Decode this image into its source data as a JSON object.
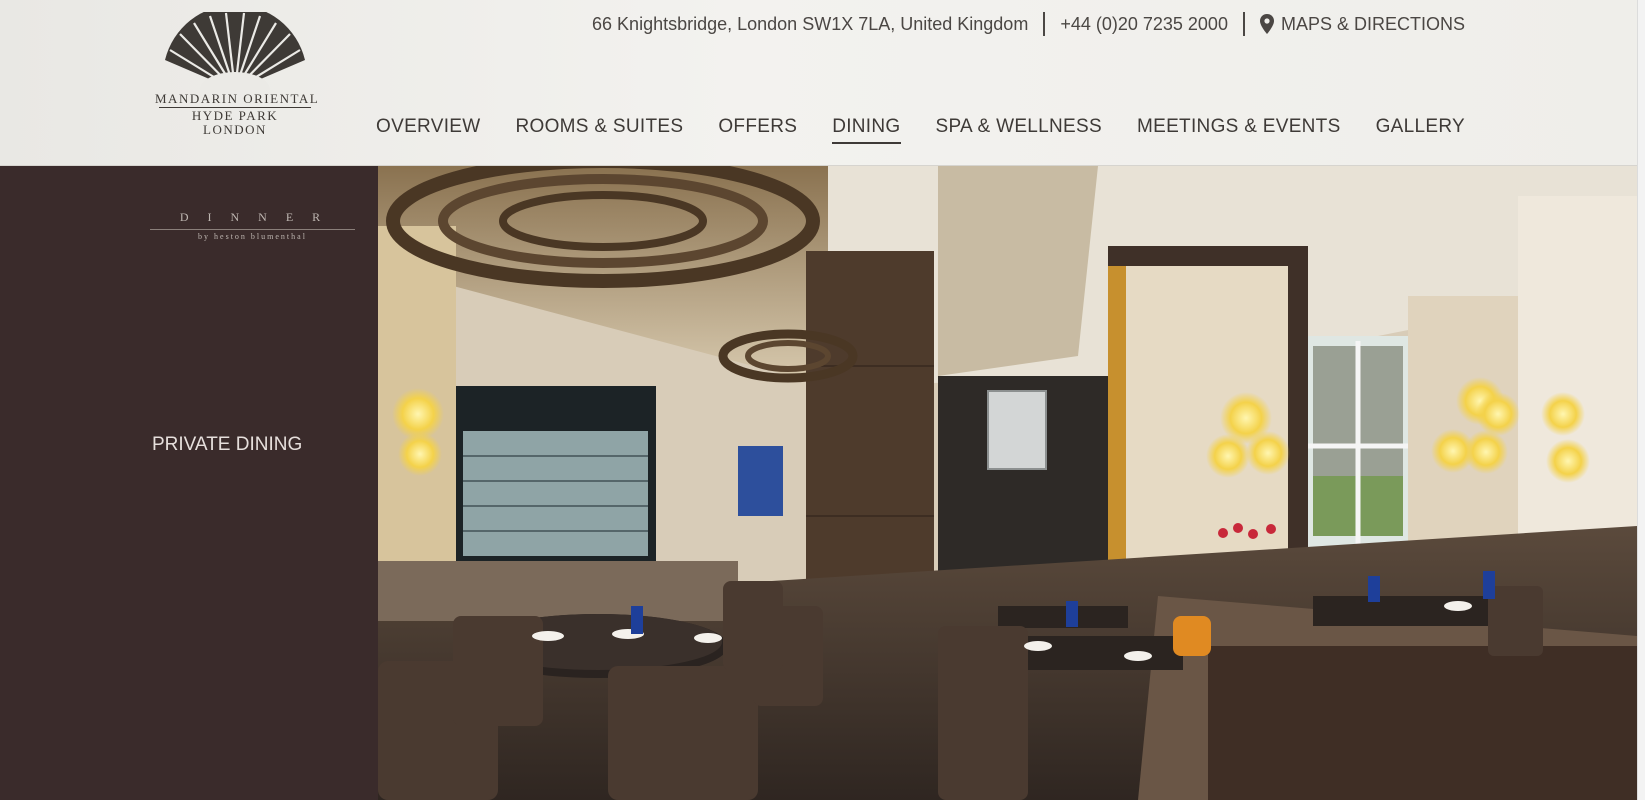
{
  "logo": {
    "line1": "MANDARIN ORIENTAL",
    "line2": "HYDE PARK",
    "line3": "LONDON"
  },
  "utility": {
    "address": "66 Knightsbridge, London SW1X 7LA, United Kingdom",
    "phone": "+44 (0)20 7235 2000",
    "maps_label": "MAPS & DIRECTIONS"
  },
  "nav": [
    {
      "label": "OVERVIEW"
    },
    {
      "label": "ROOMS & SUITES"
    },
    {
      "label": "OFFERS"
    },
    {
      "label": "DINING",
      "active": true
    },
    {
      "label": "SPA & WELLNESS"
    },
    {
      "label": "MEETINGS & EVENTS"
    },
    {
      "label": "GALLERY"
    }
  ],
  "sidebar": {
    "dinner_word": "DINNER",
    "dinner_sub": "by heston blumenthal",
    "private_dining": "PRIVATE DINING"
  },
  "colors": {
    "sidebar_bg": "#3a2b2b",
    "header_bg": "#efeeea",
    "nav_text": "#3e3a37"
  },
  "icons": {
    "maps": "map-pin-icon",
    "logo": "fan-logo-icon"
  }
}
